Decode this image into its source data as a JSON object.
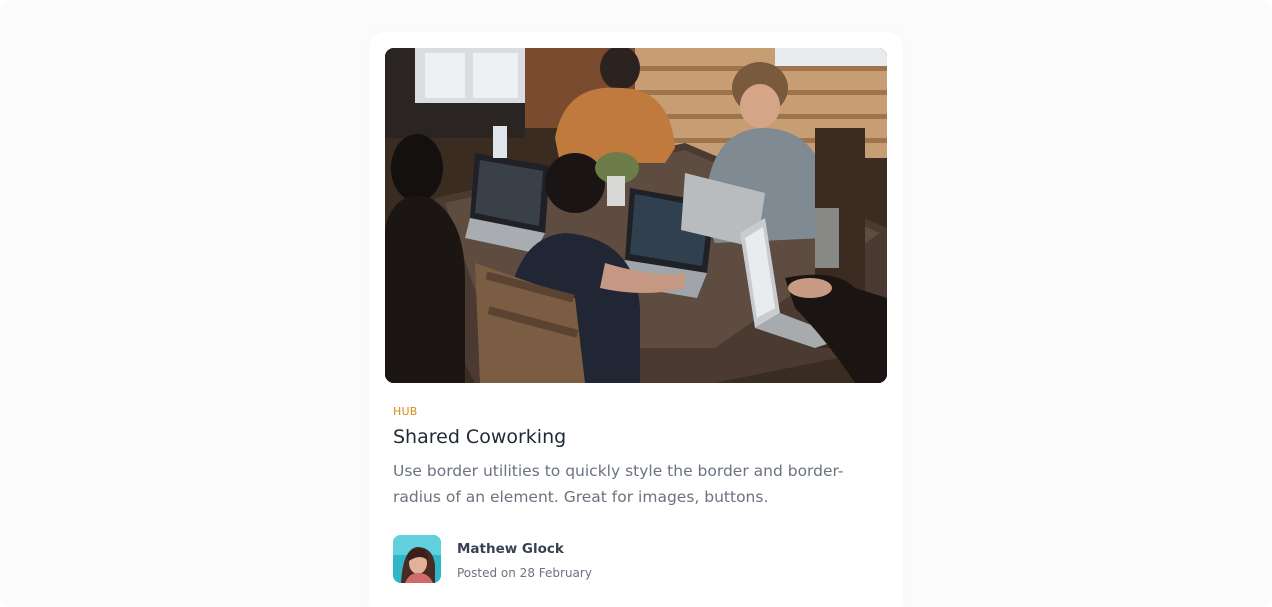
{
  "card": {
    "image_alt": "People working on laptops at a shared table",
    "category": "HUB",
    "title": "Shared Coworking",
    "description": "Use border utilities to quickly style the border and border-radius of an element. Great for images, buttons.",
    "author": {
      "name": "Mathew Glock",
      "posted": "Posted on 28 February"
    }
  },
  "colors": {
    "category": "#d98a1a",
    "title": "#1f2937",
    "description": "#6b7280",
    "avatar_background": "#2fb7c7"
  }
}
